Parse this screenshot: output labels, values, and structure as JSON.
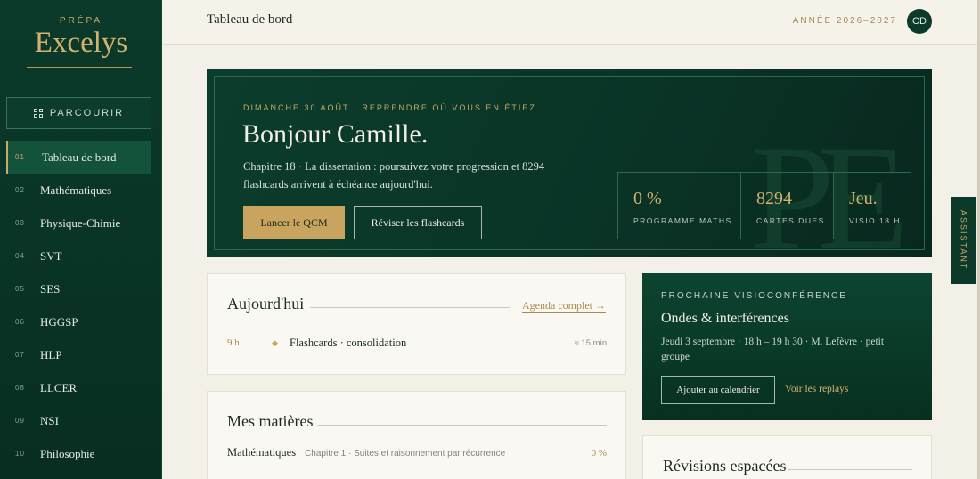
{
  "brand": {
    "small": "PRÉPA",
    "name": "Excelys"
  },
  "sidebar": {
    "browse_label": "PARCOURIR",
    "items": [
      {
        "num": "01",
        "label": "Tableau de bord",
        "active": true
      },
      {
        "num": "02",
        "label": "Mathématiques"
      },
      {
        "num": "03",
        "label": "Physique-Chimie"
      },
      {
        "num": "04",
        "label": "SVT"
      },
      {
        "num": "05",
        "label": "SES"
      },
      {
        "num": "06",
        "label": "HGGSP"
      },
      {
        "num": "07",
        "label": "HLP"
      },
      {
        "num": "08",
        "label": "LLCER"
      },
      {
        "num": "09",
        "label": "NSI"
      },
      {
        "num": "10",
        "label": "Philosophie"
      }
    ]
  },
  "header": {
    "title": "Tableau de bord",
    "year": "ANNÉE 2026–2027",
    "avatar": "CD"
  },
  "hero": {
    "eyebrow": "DIMANCHE 30 AOÛT · REPRENDRE OÙ VOUS EN ÉTIEZ",
    "greeting": "Bonjour Camille.",
    "message": "Chapitre 18 · La dissertation : poursuivez votre progression et 8294 flashcards arrivent à échéance aujourd'hui.",
    "primary_btn": "Lancer le QCM",
    "secondary_btn": "Réviser les flashcards",
    "monogram": "PE",
    "stats": [
      {
        "value": "0 %",
        "label": "PROGRAMME MATHS"
      },
      {
        "value": "8294",
        "label": "CARTES DUES"
      },
      {
        "value": "Jeu.",
        "label": "VISIO 18 H"
      }
    ]
  },
  "assistant_tab": "ASSISTANT",
  "today": {
    "title": "Aujourd'hui",
    "link": "Agenda complet →",
    "items": [
      {
        "time": "9 h",
        "bullet": "◆",
        "label": "Flashcards · consolidation",
        "duration": "≈ 15 min"
      }
    ]
  },
  "subjects": {
    "title": "Mes matières",
    "items": [
      {
        "name": "Mathématiques",
        "chapter": "Chapitre 1 · Suites et raisonnement par récurrence",
        "progress": "0 %"
      }
    ]
  },
  "visio": {
    "eyebrow": "PROCHAINE VISIOCONFÉRENCE",
    "title": "Ondes & interférences",
    "detail": "Jeudi 3 septembre · 18 h – 19 h 30 · M. Lefèvre · petit groupe",
    "calendar_btn": "Ajouter au calendrier",
    "replays_link": "Voir les replays"
  },
  "revisions": {
    "title": "Révisions espacées"
  },
  "colors": {
    "sidebar": "#0b3a2a",
    "gold": "#c9a45f",
    "background": "#f3f0e8"
  }
}
